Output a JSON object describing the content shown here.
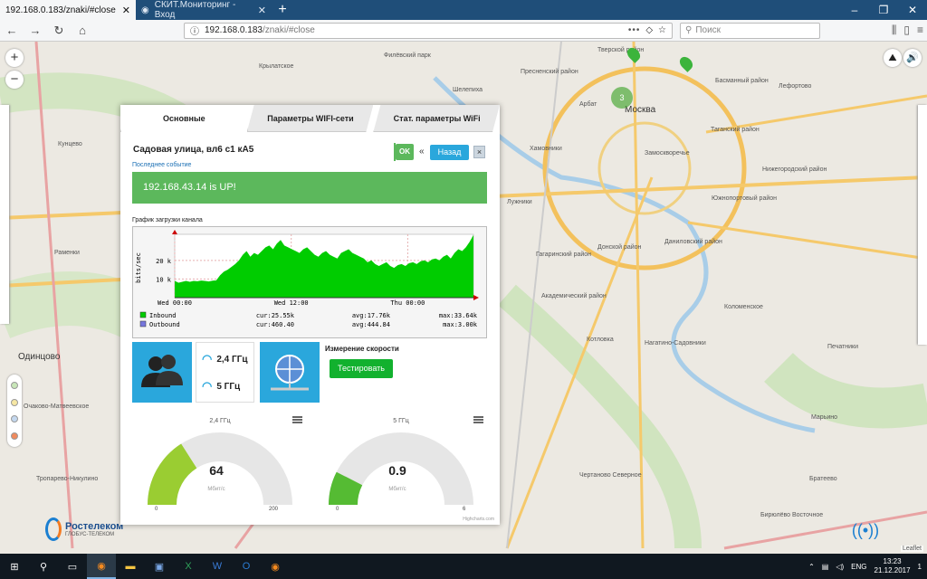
{
  "browser": {
    "tabs": [
      {
        "title": "192.168.0.183/znaki/#close",
        "active": true
      },
      {
        "title": "СКИТ.Мониторинг - Вход",
        "active": false
      }
    ],
    "url_host": "192.168.0.183",
    "url_path": "/znaki/#close",
    "search_placeholder": "Поиск"
  },
  "map": {
    "labels": [
      {
        "text": "Москва",
        "size": "big"
      },
      {
        "text": "Одинцово",
        "size": "big"
      },
      {
        "text": "Тверской район"
      },
      {
        "text": "Басманный район"
      },
      {
        "text": "Пресненский район"
      },
      {
        "text": "Лефортово"
      },
      {
        "text": "Арбат"
      },
      {
        "text": "Таганский район"
      },
      {
        "text": "Замоскворечье"
      },
      {
        "text": "Хамовники"
      },
      {
        "text": "Нижегородский район"
      },
      {
        "text": "Южнопортовый район"
      },
      {
        "text": "Даниловский район"
      },
      {
        "text": "Донской район"
      },
      {
        "text": "Гагаринский район"
      },
      {
        "text": "Академический район"
      },
      {
        "text": "Котловка"
      },
      {
        "text": "Нагатино-Садовники"
      },
      {
        "text": "Печатники"
      },
      {
        "text": "Марьино"
      },
      {
        "text": "Братеево"
      },
      {
        "text": "Кунцево"
      },
      {
        "text": "Крылатское"
      },
      {
        "text": "Филёвский парк"
      },
      {
        "text": "Шелепиха"
      },
      {
        "text": "Раменки"
      },
      {
        "text": "Очаково-Матвеевское"
      },
      {
        "text": "Тропарево-Никулино"
      },
      {
        "text": "Лужники"
      },
      {
        "text": "Коломенское"
      },
      {
        "text": "Чертаново Северное"
      },
      {
        "text": "Бирюлёво Восточное"
      }
    ],
    "cluster_count": "3",
    "attribution": "Leaflet"
  },
  "brand": {
    "name": "Ростелеком",
    "sub": "ГЛОБУС-ТЕЛЕКОМ"
  },
  "dialog": {
    "tabs": [
      "Основные",
      "Параметры WIFI-сети",
      "Стат. параметры WiFi"
    ],
    "active_tab": 0,
    "header": "Садовая улица, вл6 с1 кА5",
    "ok_label": "OK",
    "back_nav": "«",
    "back_label": "Назад",
    "close_label": "×",
    "last_event_label": "Последнее событие",
    "status_text": "192.168.43.14 is UP!",
    "chart_title": "График загрузки канала",
    "wifi": [
      {
        "label": "2,4 ГГц"
      },
      {
        "label": "5 ГГц"
      }
    ],
    "speed_title": "Измерение скорости",
    "test_button": "Тестировать",
    "credits": "Highcharts.com"
  },
  "chart_data": [
    {
      "type": "area",
      "ylabel": "bits/sec",
      "x_ticks": [
        "Wed 00:00",
        "Wed 12:00",
        "Thu 00:00"
      ],
      "y_ticks": [
        "20 k",
        "10 k"
      ],
      "ylim": [
        0,
        34000
      ],
      "series": [
        {
          "name": "Inbound",
          "color": "#00cc00",
          "cur": "25.55k",
          "avg": "17.76k",
          "max": "33.64k",
          "values": [
            9000,
            8000,
            8500,
            9000,
            8500,
            9000,
            8800,
            9200,
            9000,
            8700,
            9100,
            9300,
            12000,
            14000,
            15000,
            16500,
            18000,
            20000,
            23000,
            25000,
            22000,
            24000,
            23000,
            25000,
            27000,
            28000,
            26000,
            29000,
            31000,
            28000,
            27000,
            26000,
            25000,
            24000,
            26000,
            27000,
            25000,
            23000,
            22000,
            24000,
            25000,
            23000,
            22000,
            21000,
            24000,
            25000,
            26000,
            24000,
            23000,
            22000,
            21000,
            19000,
            20000,
            18000,
            17000,
            18000,
            19000,
            17000,
            16000,
            17500,
            18000,
            17000,
            18500,
            19000,
            18000,
            19500,
            20000,
            19000,
            20500,
            21000,
            20000,
            22000,
            23000,
            21000,
            24000,
            26000,
            25000,
            27000,
            30000,
            33640
          ]
        },
        {
          "name": "Outbound",
          "color": "#7777dd",
          "cur": "460.40",
          "avg": "444.84",
          "max": "3.00k",
          "values": []
        }
      ]
    },
    {
      "type": "gauge",
      "title": "2,4 ГГц",
      "value": 64,
      "min": 0,
      "max": 200,
      "unit": "Мбит/с",
      "color": "#9acd32"
    },
    {
      "type": "gauge",
      "title": "5 ГГц",
      "value": 0.9,
      "min": 0,
      "max": 6,
      "unit": "Мбит/с",
      "color": "#55bb33"
    }
  ],
  "taskbar": {
    "lang": "ENG",
    "time": "13:23",
    "date": "21.12.2017",
    "notifications": "1"
  }
}
